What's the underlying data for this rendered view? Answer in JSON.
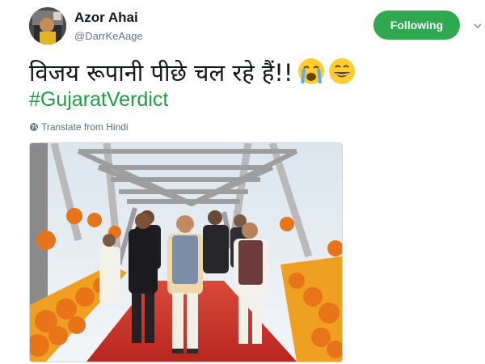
{
  "user": {
    "display_name": "Azor Ahai",
    "handle": "@DarrKeAage",
    "avatar_icon": "avatar-portrait"
  },
  "follow_button": {
    "label": "Following",
    "color": "#2fa84f"
  },
  "menu": {
    "icon": "chevron-down-icon"
  },
  "tweet": {
    "text": "विजय रूपानी पीछे चल रहे हैं!!",
    "emojis": [
      "loudly-crying-face-emoji",
      "grinning-face-emoji"
    ],
    "hashtag": "#GujaratVerdict",
    "hashtag_color": "#1da043"
  },
  "translate": {
    "label": "Translate from Hindi",
    "icon": "globe-icon"
  },
  "media": {
    "type": "photo",
    "subject": "men walking across a garlanded steel truss bridge"
  }
}
